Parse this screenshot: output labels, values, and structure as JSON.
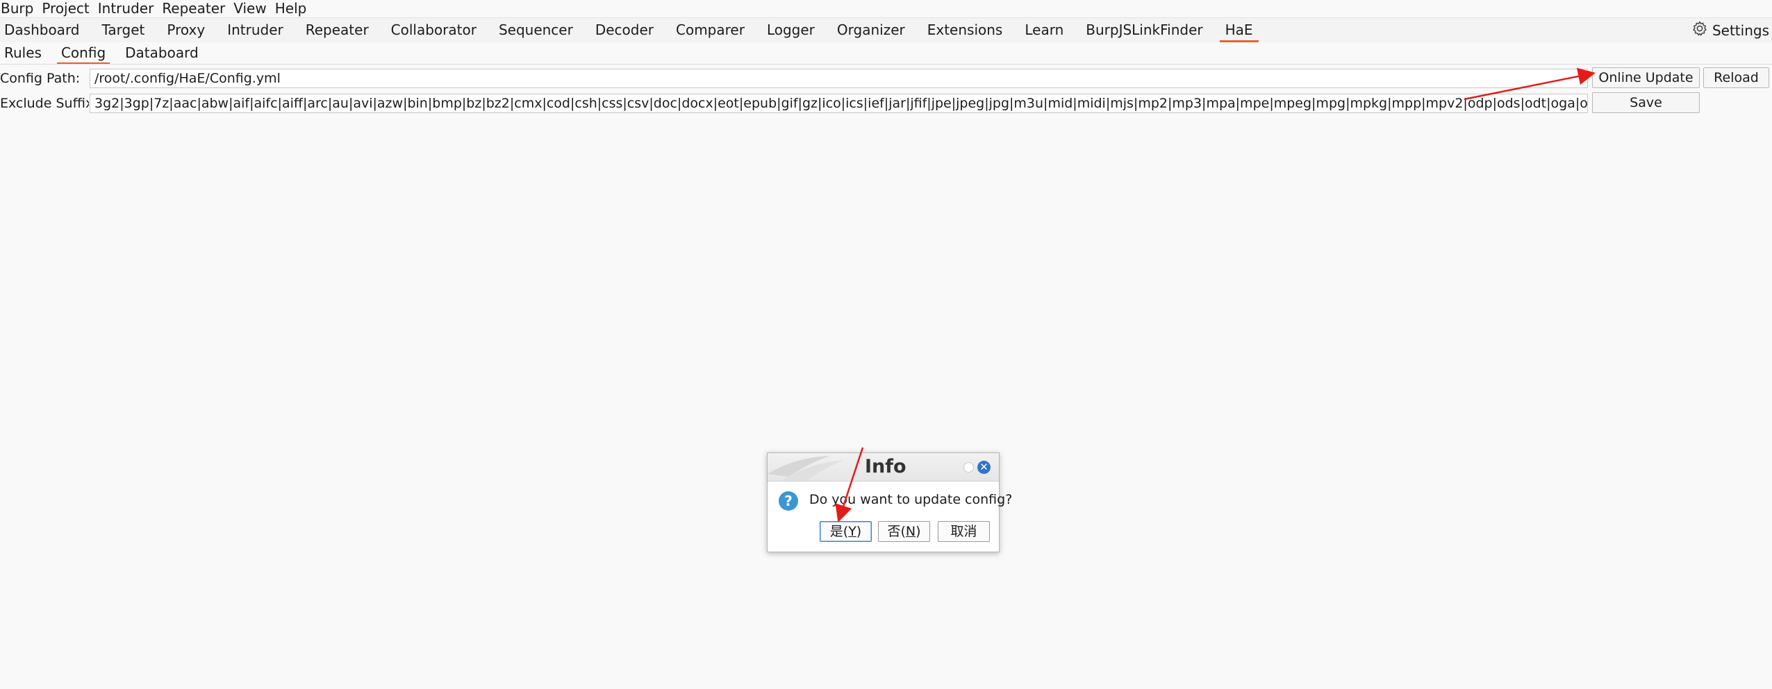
{
  "menu": [
    "Burp",
    "Project",
    "Intruder",
    "Repeater",
    "View",
    "Help"
  ],
  "tabs": [
    "Dashboard",
    "Target",
    "Proxy",
    "Intruder",
    "Repeater",
    "Collaborator",
    "Sequencer",
    "Decoder",
    "Comparer",
    "Logger",
    "Organizer",
    "Extensions",
    "Learn",
    "BurpJSLinkFinder",
    "HaE"
  ],
  "active_tab": "HaE",
  "settings_label": "Settings",
  "subtabs": [
    "Rules",
    "Config",
    "Databoard"
  ],
  "active_subtab": "Config",
  "config": {
    "path_label": "Config Path:",
    "path_value": "/root/.config/HaE/Config.yml",
    "suffix_label": "Exclude Suffix:",
    "suffix_value": "3g2|3gp|7z|aac|abw|aif|aifc|aiff|arc|au|avi|azw|bin|bmp|bz|bz2|cmx|cod|csh|css|csv|doc|docx|eot|epub|gif|gz|ico|ics|ief|jar|jfif|jpe|jpeg|jpg|m3u|mid|midi|mjs|mp2|mp3|mpa|mpe|mpeg|mpg|mpkg|mpp|mpv2|odp|ods|odt|oga|ogv|ogx|otf|pbm|pdf|pgm",
    "online_update": "Online Update",
    "reload": "Reload",
    "save": "Save"
  },
  "dialog": {
    "title": "Info",
    "message": "Do you want to update config?",
    "yes_label": "是(",
    "yes_key": "Y",
    "no_label": "否(",
    "no_key": "N",
    "close_paren": ")",
    "cancel_label": "取消"
  },
  "colors": {
    "accent": "#e8622c",
    "annotation": "#e41b1b",
    "dialog_close": "#2f75c8",
    "question_icon": "#3a96d6"
  },
  "icons": {
    "settings": "gear-icon",
    "question": "question-icon",
    "close": "close-icon"
  }
}
